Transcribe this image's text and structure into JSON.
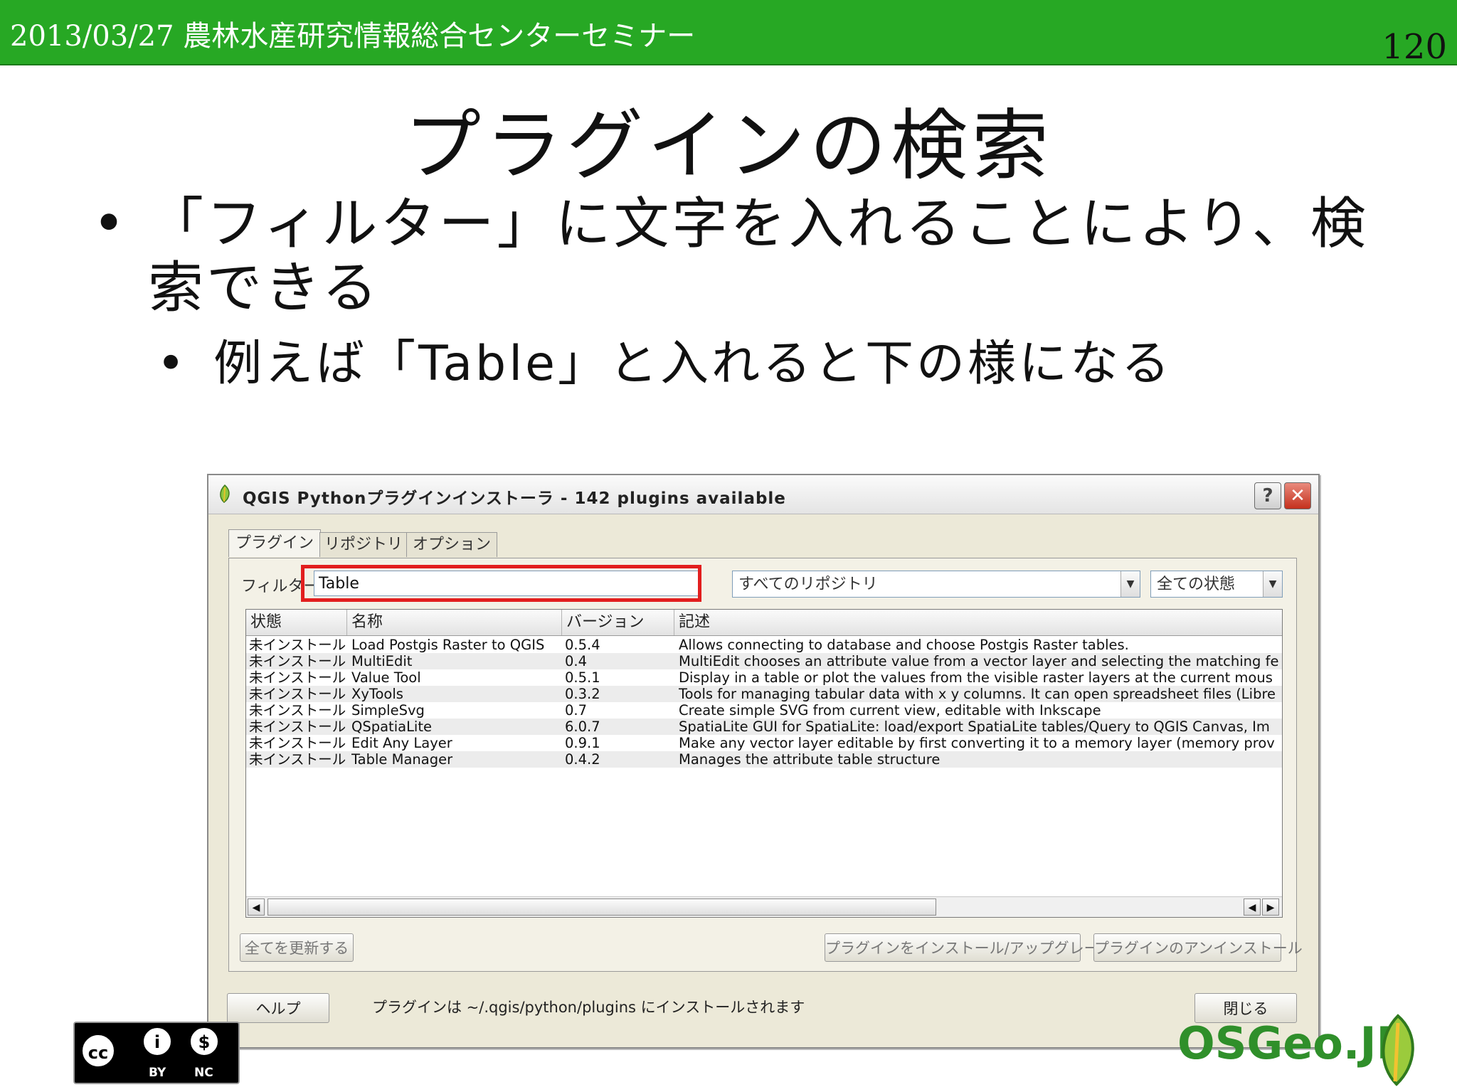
{
  "slide": {
    "header": "2013/03/27 農林水産研究情報総合センターセミナー",
    "page_number": "120",
    "title": "プラグインの検索",
    "bullet1": "「フィルター」に文字を入れることにより、検索できる",
    "bullet2": "例えば「Table」と入れると下の様になる",
    "bullet_symbol": "•",
    "green": "#27a824"
  },
  "dialog": {
    "title": "QGIS Pythonプラグインインストーラ - 142 plugins available",
    "help_button": "?",
    "close_button": "✕",
    "tabs": [
      "プラグイン",
      "リポジトリ",
      "オプション"
    ],
    "filter_label": "フィルター",
    "filter_value": "Table",
    "repository_select": "すべてのリポジトリ",
    "status_select": "全ての状態",
    "columns": [
      "状態",
      "名称",
      "バージョン",
      "記述"
    ],
    "rows": [
      {
        "status": "未インストール",
        "name": "Load Postgis Raster to QGIS",
        "version": "0.5.4",
        "desc": "Allows connecting to database and choose Postgis Raster tables."
      },
      {
        "status": "未インストール",
        "name": "MultiEdit",
        "version": "0.4",
        "desc": "MultiEdit chooses an attribute value from a vector layer and selecting the matching fe"
      },
      {
        "status": "未インストール",
        "name": "Value Tool",
        "version": "0.5.1",
        "desc": "Display in a table or plot the values from the visible raster layers at the current mous"
      },
      {
        "status": "未インストール",
        "name": "XyTools",
        "version": "0.3.2",
        "desc": "Tools for managing tabular data with x y columns. It can open spreadsheet files (Libre"
      },
      {
        "status": "未インストール",
        "name": "SimpleSvg",
        "version": "0.7",
        "desc": "Create simple SVG from current view, editable with Inkscape"
      },
      {
        "status": "未インストール",
        "name": "QSpatiaLite",
        "version": "6.0.7",
        "desc": "SpatiaLite GUI for SpatiaLite: load/export SpatiaLite tables/Query to QGIS Canvas, Im"
      },
      {
        "status": "未インストール",
        "name": "Edit Any Layer",
        "version": "0.9.1",
        "desc": "Make any vector layer editable by first converting it to a memory layer (memory prov"
      },
      {
        "status": "未インストール",
        "name": "Table Manager",
        "version": "0.4.2",
        "desc": "Manages the attribute table structure"
      }
    ],
    "update_all_button": "全てを更新する",
    "install_button": "プラグインをインストール/アップグレード",
    "uninstall_button": "プラグインのアンインストール",
    "help_text_button": "ヘルプ",
    "info_text": "プラグインは ~/.qgis/python/plugins にインストールされます",
    "close_text_button": "閉じる"
  },
  "footer": {
    "cc_by": "BY",
    "cc_nc": "NC",
    "osgeo_logo_text": "OSGeo.JP"
  }
}
